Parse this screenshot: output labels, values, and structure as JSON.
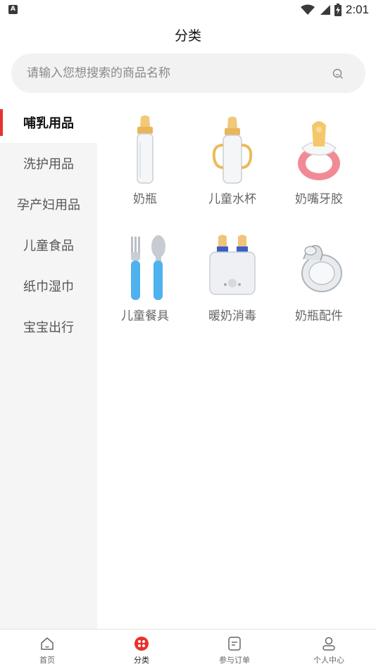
{
  "status_bar": {
    "time": "2:01",
    "left_badge": "A"
  },
  "header": {
    "title": "分类"
  },
  "search": {
    "placeholder": "请输入您想搜索的商品名称"
  },
  "sidebar": {
    "items": [
      {
        "label": "哺乳用品",
        "active": true
      },
      {
        "label": "洗护用品",
        "active": false
      },
      {
        "label": "孕产妇用品",
        "active": false
      },
      {
        "label": "儿童食品",
        "active": false
      },
      {
        "label": "纸巾湿巾",
        "active": false
      },
      {
        "label": "宝宝出行",
        "active": false
      }
    ]
  },
  "products": [
    {
      "label": "奶瓶",
      "icon": "baby-bottle-icon"
    },
    {
      "label": "儿童水杯",
      "icon": "sippy-cup-icon"
    },
    {
      "label": "奶嘴牙胶",
      "icon": "pacifier-icon"
    },
    {
      "label": "儿童餐具",
      "icon": "kids-cutlery-icon"
    },
    {
      "label": "暖奶消毒",
      "icon": "bottle-warmer-icon"
    },
    {
      "label": "奶瓶配件",
      "icon": "nipple-icon"
    }
  ],
  "bottom_nav": {
    "items": [
      {
        "label": "首页",
        "icon": "home-icon"
      },
      {
        "label": "分类",
        "icon": "category-icon",
        "active": true
      },
      {
        "label": "参与订单",
        "icon": "order-icon"
      },
      {
        "label": "个人中心",
        "icon": "user-icon"
      }
    ]
  },
  "colors": {
    "accent": "#e8322e",
    "sidebar_bg": "#f5f5f5",
    "search_bg": "#f2f2f2"
  }
}
